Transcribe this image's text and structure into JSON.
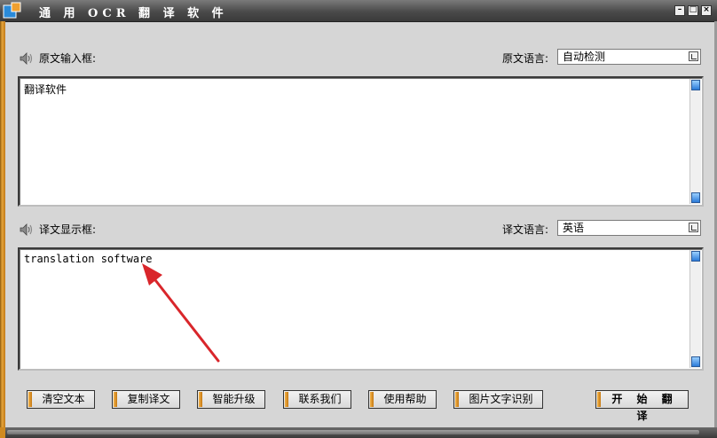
{
  "window": {
    "title": "通 用 OCR 翻 译 软 件",
    "controls": [
      "minimize",
      "maximize",
      "close"
    ]
  },
  "source": {
    "label": "原文输入框:",
    "lang_label": "原文语言:",
    "lang_value": "自动检测",
    "text": "翻译软件"
  },
  "target": {
    "label": "译文显示框:",
    "lang_label": "译文语言:",
    "lang_value": "英语",
    "text": "translation software"
  },
  "buttons": {
    "clear": "清空文本",
    "copy": "复制译文",
    "upgrade": "智能升级",
    "contact": "联系我们",
    "help": "使用帮助",
    "ocr": "图片文字识别",
    "start": "开 始 翻 译"
  },
  "colors": {
    "accent": "#e6a43a",
    "annotation_arrow": "#d9262b",
    "titlebar": "#4a4a4a"
  },
  "icons": [
    "app-logo-icon",
    "speaker-icon",
    "dropdown-icon",
    "scroll-up-icon",
    "scroll-down-icon"
  ]
}
